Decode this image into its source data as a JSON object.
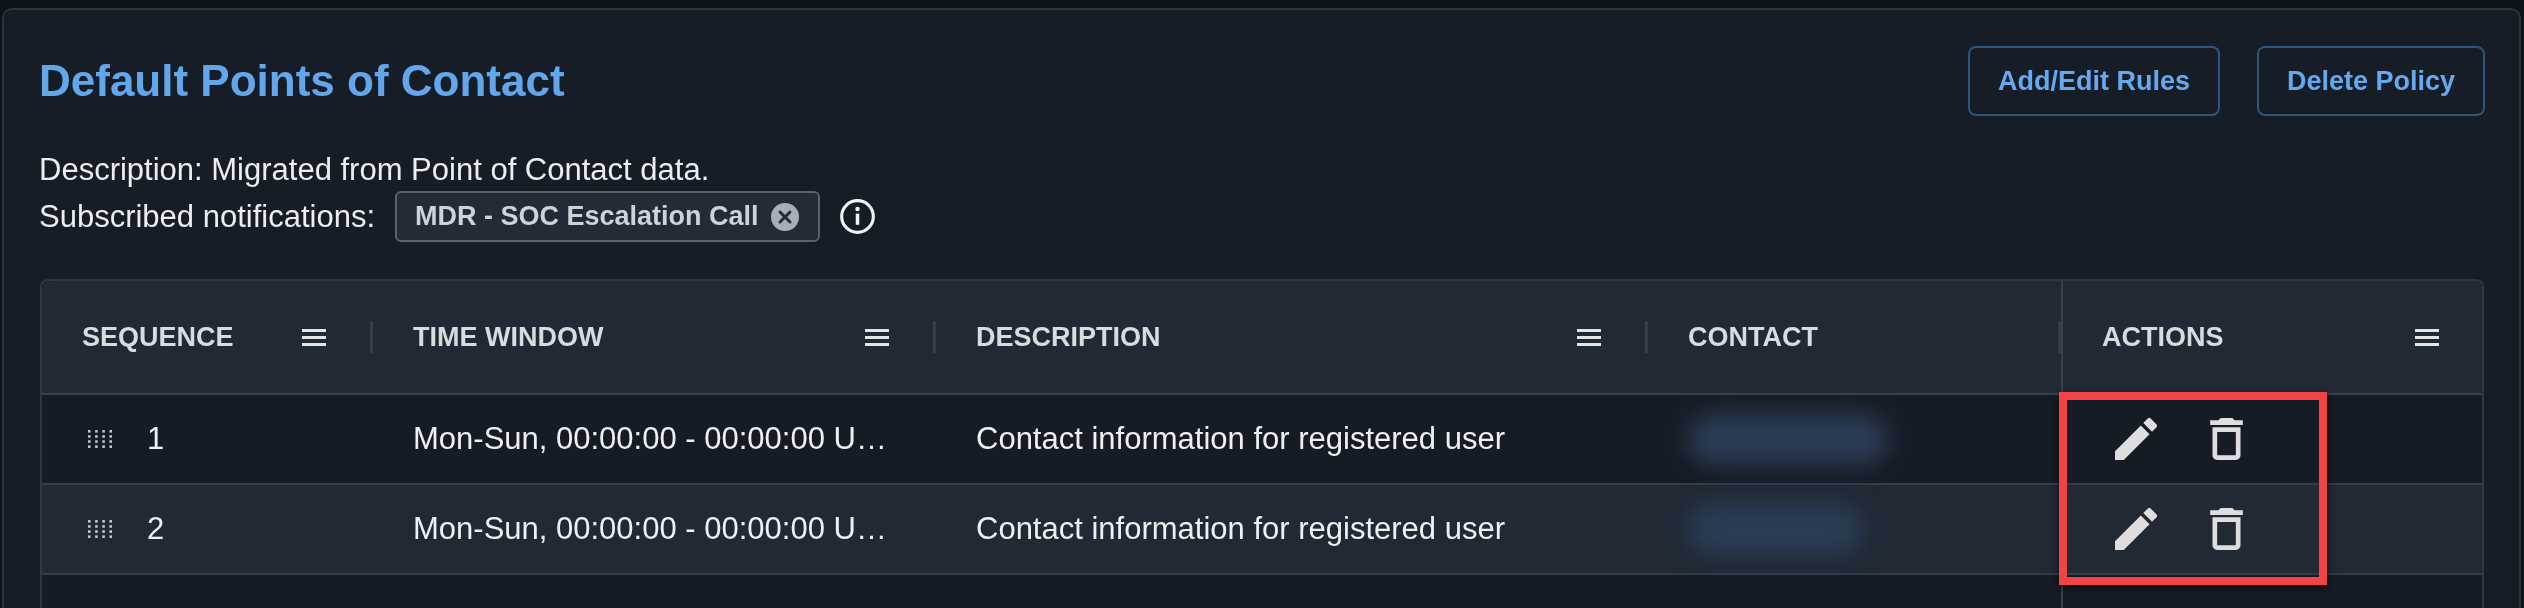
{
  "header": {
    "title": "Default Points of Contact",
    "buttons": [
      {
        "label": "Add/Edit Rules"
      },
      {
        "label": "Delete Policy"
      }
    ]
  },
  "info": {
    "description": "Description: Migrated from Point of Contact data.",
    "subscriptions_label": "Subscribed notifications:",
    "subscriptions": [
      {
        "label": "MDR - SOC Escalation Call"
      }
    ]
  },
  "table": {
    "columns": [
      {
        "label": "SEQUENCE",
        "menu": true
      },
      {
        "label": "TIME WINDOW",
        "menu": true
      },
      {
        "label": "DESCRIPTION",
        "menu": true
      },
      {
        "label": "CONTACT",
        "menu": false
      },
      {
        "label": "ACTIONS",
        "menu": true
      }
    ],
    "rows": [
      {
        "sequence": "1",
        "time_window": "Mon-Sun, 00:00:00 - 00:00:00 U…",
        "description": "Contact information for registered user",
        "contact_blurred": true
      },
      {
        "sequence": "2",
        "time_window": "Mon-Sun, 00:00:00 - 00:00:00 U…",
        "description": "Contact information for registered user",
        "contact_blurred": true
      }
    ],
    "actions_highlighted": true
  }
}
